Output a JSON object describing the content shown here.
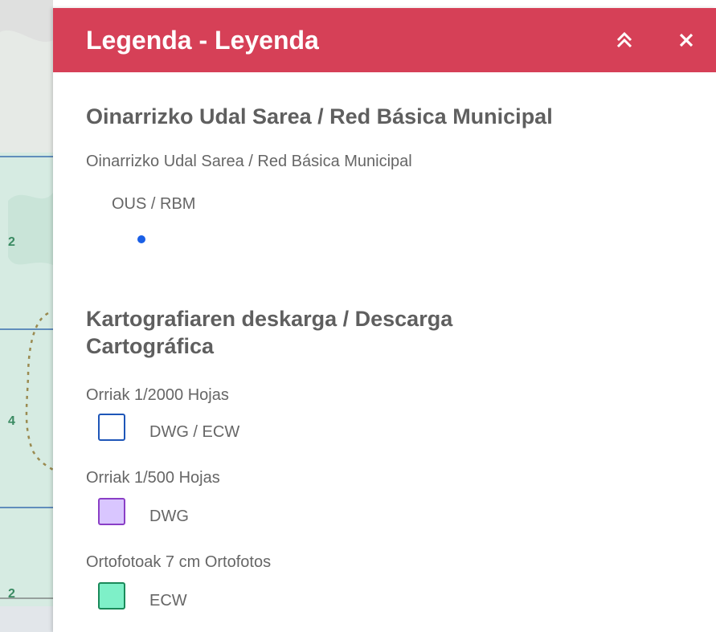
{
  "panel": {
    "title": "Legenda - Leyenda",
    "collapse_icon": "double-chevron-up-icon",
    "close_icon": "close-icon"
  },
  "map": {
    "labels": [
      "2",
      "4",
      "2"
    ]
  },
  "sections": [
    {
      "title": "Oinarrizko Udal Sarea / Red Básica Municipal",
      "layer_name": "Oinarrizko Udal Sarea / Red Básica Municipal",
      "item": {
        "label": "OUS / RBM",
        "symbol": "point",
        "color": "#1a5fe6"
      }
    },
    {
      "title": "Kartografiaren deskarga / Descarga Cartográfica",
      "layers": [
        {
          "name": "Orriak 1/2000 Hojas",
          "label": "DWG / ECW",
          "fill": "#ffffff",
          "stroke": "#1e56b8"
        },
        {
          "name": "Orriak 1/500 Hojas",
          "label": "DWG",
          "fill": "#d9c6ff",
          "stroke": "#8a3fc6"
        },
        {
          "name": "Ortofotoak 7 cm Ortofotos",
          "label": "ECW",
          "fill": "#7ef0c8",
          "stroke": "#1a8a5a"
        }
      ]
    }
  ]
}
